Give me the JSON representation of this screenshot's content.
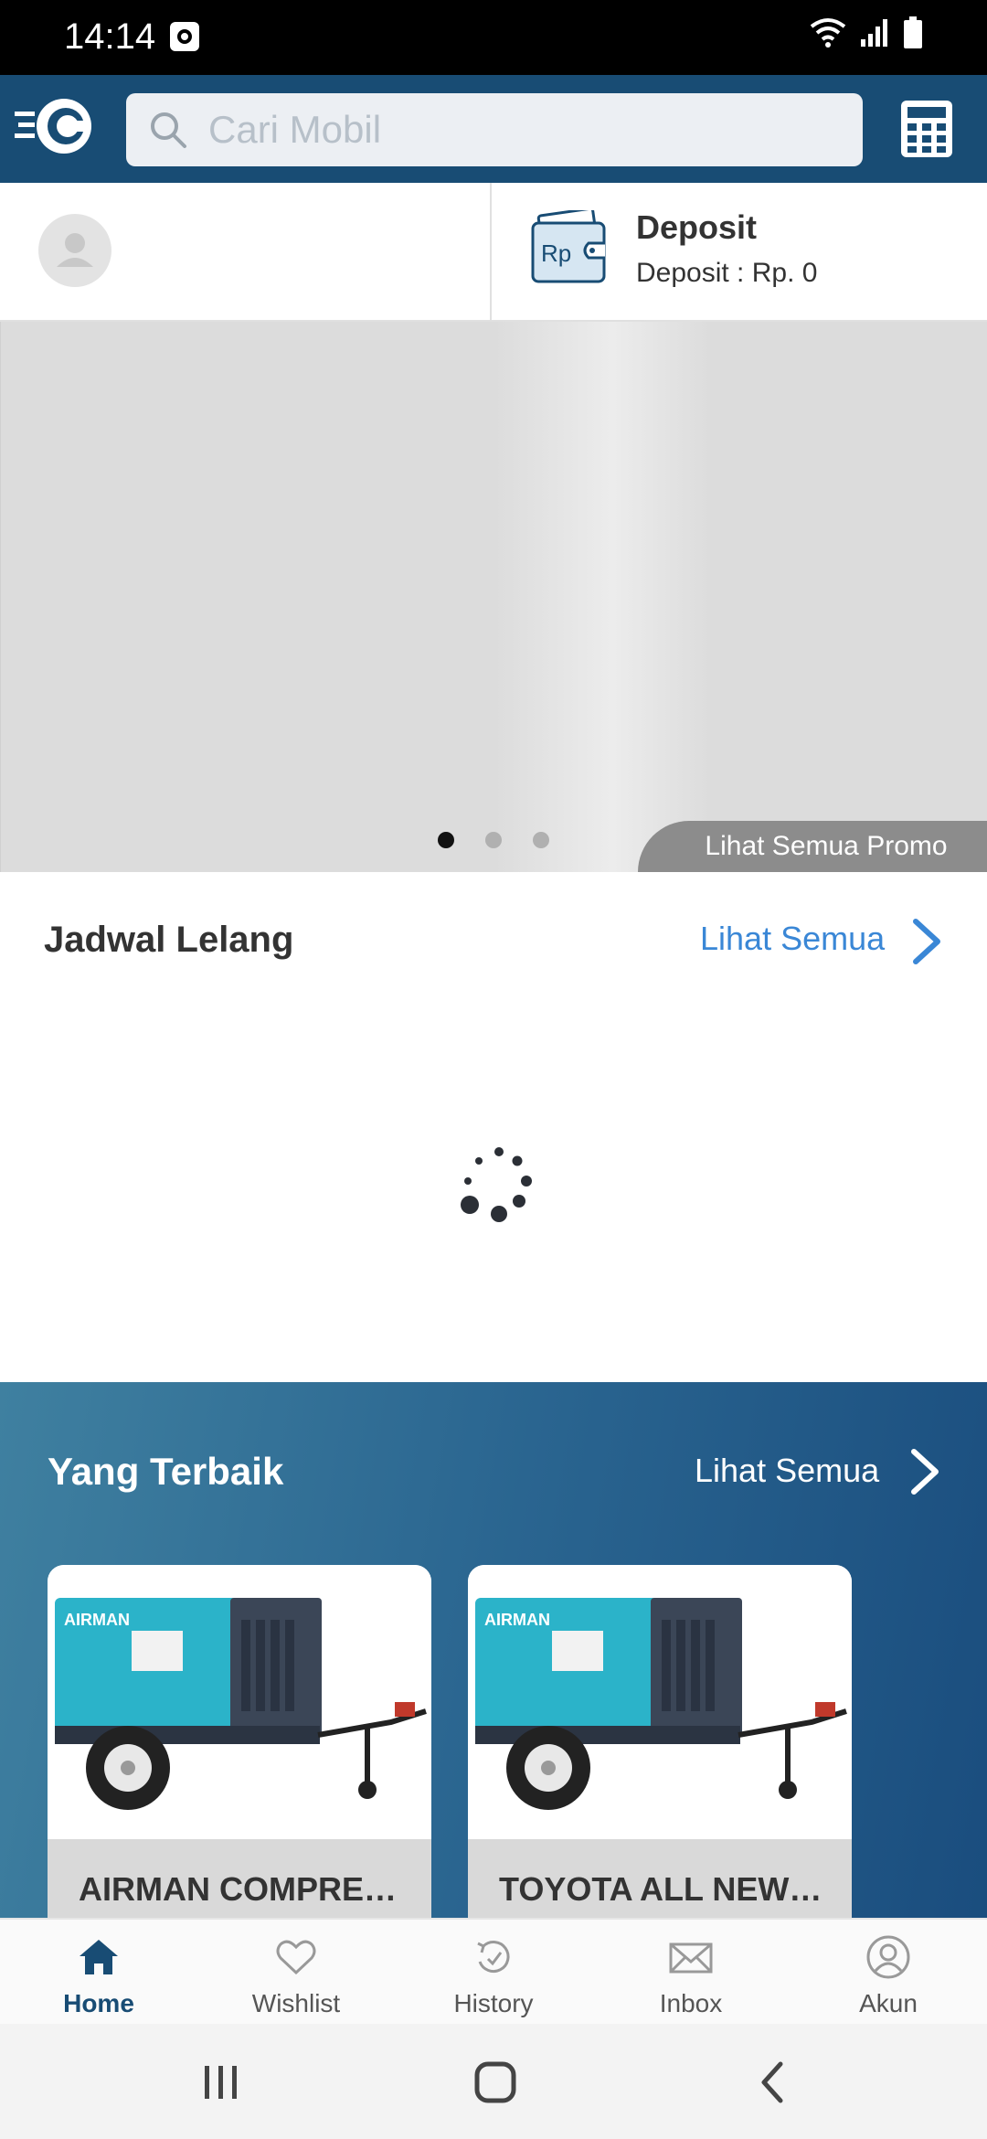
{
  "status_bar": {
    "time": "14:14"
  },
  "header": {
    "search_placeholder": "Cari Mobil",
    "brand_color": "#184c74"
  },
  "deposit": {
    "title": "Deposit",
    "subtitle": "Deposit : Rp. 0",
    "wallet_text": "Rp"
  },
  "banner": {
    "promo_button": "Lihat Semua Promo",
    "dots": 3,
    "active_dot": 0
  },
  "jadwal": {
    "title": "Jadwal Lelang",
    "see_all": "Lihat Semua",
    "accent_color": "#3a87d6"
  },
  "best": {
    "title": "Yang Terbaik",
    "see_all": "Lihat Semua",
    "cards": [
      {
        "label": "AIRMAN COMPRE…",
        "brand": "AIRMAN"
      },
      {
        "label": "TOYOTA ALL NEW…",
        "brand": "AIRMAN"
      }
    ]
  },
  "bottom_nav": [
    {
      "label": "Home",
      "icon": "home-icon",
      "active": true
    },
    {
      "label": "Wishlist",
      "icon": "heart-icon",
      "active": false
    },
    {
      "label": "History",
      "icon": "history-icon",
      "active": false
    },
    {
      "label": "Inbox",
      "icon": "mail-icon",
      "active": false
    },
    {
      "label": "Akun",
      "icon": "user-icon",
      "active": false
    }
  ]
}
